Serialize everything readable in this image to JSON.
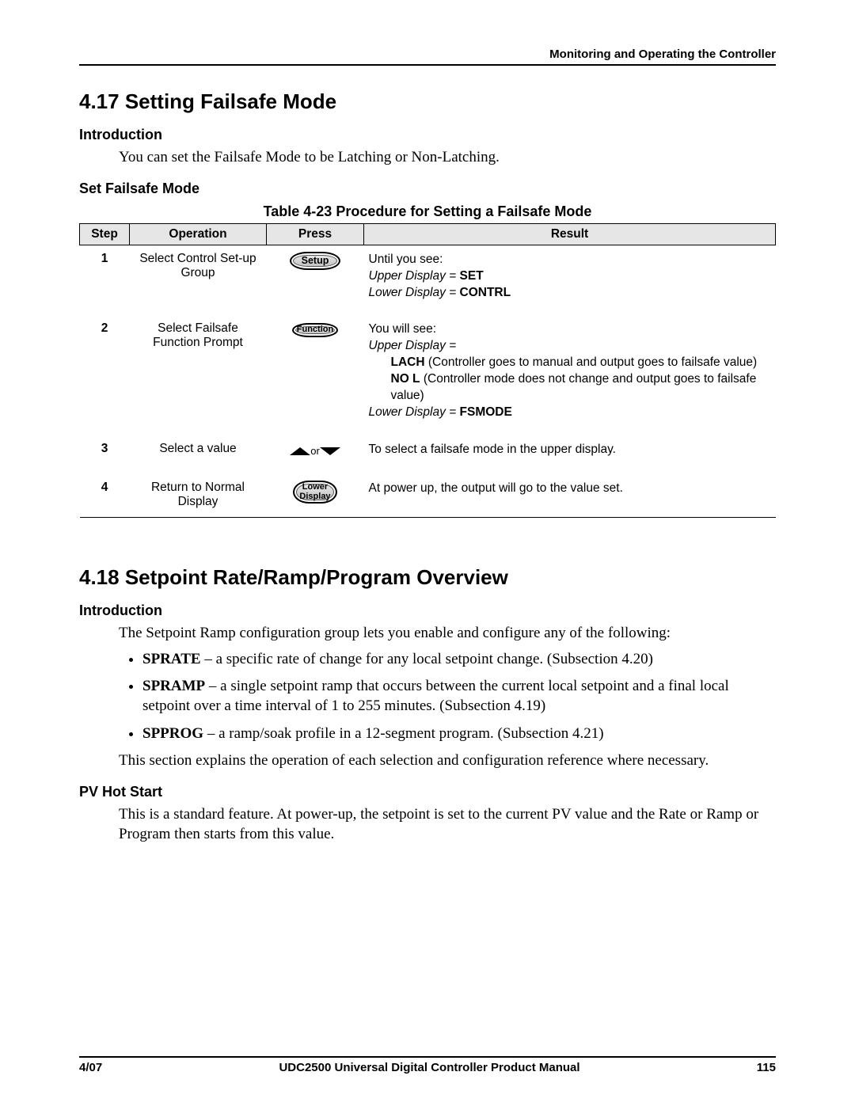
{
  "header": {
    "right": "Monitoring and Operating the Controller"
  },
  "sec417": {
    "title": "4.17  Setting Failsafe Mode",
    "intro_h": "Introduction",
    "intro_p": "You can set the Failsafe Mode to be Latching or Non-Latching.",
    "set_h": "Set Failsafe Mode",
    "table_caption": "Table 4-23  Procedure for Setting a Failsafe Mode",
    "th": {
      "step": "Step",
      "op": "Operation",
      "press": "Press",
      "res": "Result"
    },
    "rows": [
      {
        "step": "1",
        "op": "Select Control Set-up Group",
        "btn": "Setup",
        "res": {
          "line1": "Until you see:",
          "line2_i": "Upper Display = ",
          "line2_b": "SET",
          "line3_i": "Lower Display = ",
          "line3_b": "CONTRL"
        }
      },
      {
        "step": "2",
        "op": "Select Failsafe Function Prompt",
        "btn": "Function",
        "res": {
          "line1": "You will see:",
          "line2_i": "Upper Display =",
          "opt1_b": "LACH",
          "opt1_t": "  (Controller goes to manual and output goes to failsafe value)",
          "opt2_b": "NO L",
          "opt2_t": "  (Controller mode does not change and output goes to failsafe value)",
          "line3_i": "Lower Display = ",
          "line3_b": "FSMODE"
        }
      },
      {
        "step": "3",
        "op": "Select a value",
        "btn_arrows_or": "or",
        "res": {
          "line1": "To select a failsafe mode in the upper display."
        }
      },
      {
        "step": "4",
        "op": "Return to Normal Display",
        "btn_multi": [
          "Lower",
          "Display"
        ],
        "res": {
          "line1": "At power up, the output will go to the value set."
        }
      }
    ]
  },
  "sec418": {
    "title": "4.18  Setpoint Rate/Ramp/Program Overview",
    "intro_h": "Introduction",
    "intro_p": "The Setpoint Ramp configuration group lets you enable and configure any of the following:",
    "bullets": [
      {
        "b": "SPRATE",
        "t": " – a specific rate of change for any local setpoint change.  (Subsection 4.20)"
      },
      {
        "b": "SPRAMP",
        "t": " – a single setpoint ramp that occurs between the current local setpoint and a final local setpoint over a time interval of 1 to 255 minutes.  (Subsection 4.19)"
      },
      {
        "b": "SPPROG",
        "t": " – a ramp/soak profile in a 12-segment program. (Subsection 4.21)"
      }
    ],
    "p2": "This section explains the operation of each selection and configuration reference where necessary.",
    "pv_h": "PV Hot Start",
    "pv_p": "This is a standard feature.  At power-up, the setpoint is set to the current PV value and the Rate or Ramp or Program then starts from this value."
  },
  "footer": {
    "left": "4/07",
    "center": "UDC2500 Universal Digital Controller Product Manual",
    "right": "115"
  }
}
